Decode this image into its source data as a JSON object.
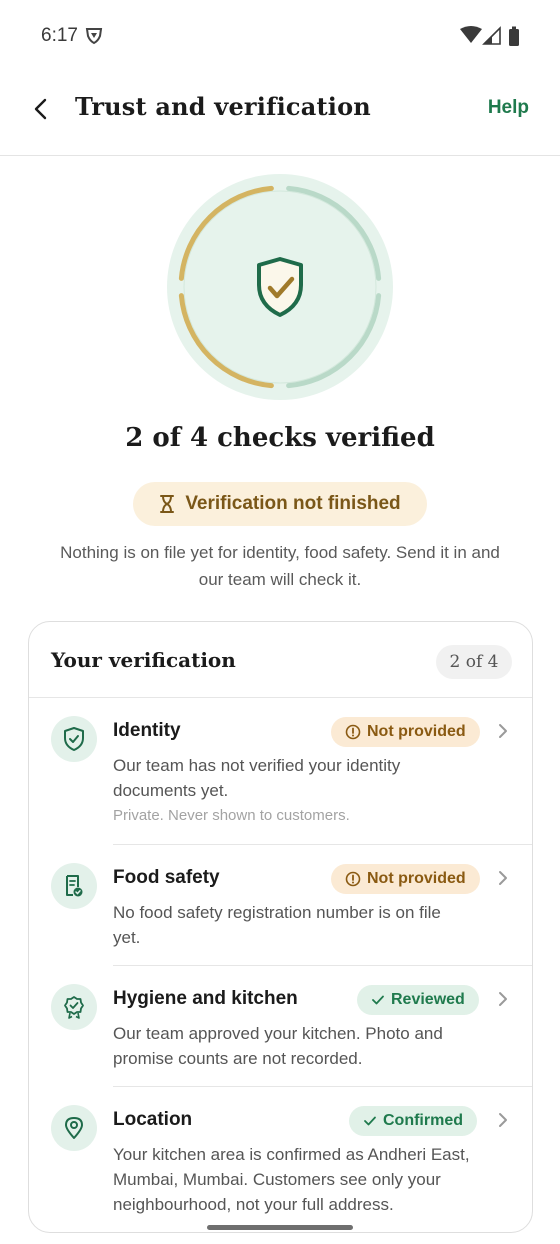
{
  "status_bar": {
    "time": "6:17"
  },
  "app_bar": {
    "title": "Trust and verification",
    "help_label": "Help"
  },
  "summary": {
    "checks_verified": 2,
    "checks_total": 4,
    "title": "2 of 4 checks verified",
    "pill_label": "Verification not finished",
    "description": "Nothing is on file yet for identity, food safety. Send it in and our team will check it."
  },
  "colors": {
    "accent": "#1f7a4d",
    "gold": "#d4b462",
    "mint": "#b9d9c8",
    "warn_bg": "#fbead4",
    "warn_text": "#8a5a12",
    "ok_bg": "#e1f1e8"
  },
  "card": {
    "title": "Your verification",
    "count": "2 of 4",
    "items": [
      {
        "title": "Identity",
        "badge": "Not provided",
        "badge_icon": "info-circle-icon",
        "status": "warning",
        "icon": "shield-check-icon",
        "description": "Our team has not verified your identity documents yet.",
        "note": "Private. Never shown to customers."
      },
      {
        "title": "Food safety",
        "badge": "Not provided",
        "badge_icon": "info-circle-icon",
        "status": "warning",
        "icon": "document-check-icon",
        "description": "No food safety registration number is on file yet."
      },
      {
        "title": "Hygiene and kitchen",
        "badge": "Reviewed",
        "badge_icon": "check-icon",
        "status": "ok",
        "icon": "award-badge-icon",
        "description": "Our team approved your kitchen. Photo and promise counts are not recorded."
      },
      {
        "title": "Location",
        "badge": "Confirmed",
        "badge_icon": "check-icon",
        "status": "ok",
        "icon": "location-pin-icon",
        "description": "Your kitchen area is confirmed as Andheri East, Mumbai, Mumbai. Customers see only your neighbourhood, not your full address."
      }
    ]
  }
}
